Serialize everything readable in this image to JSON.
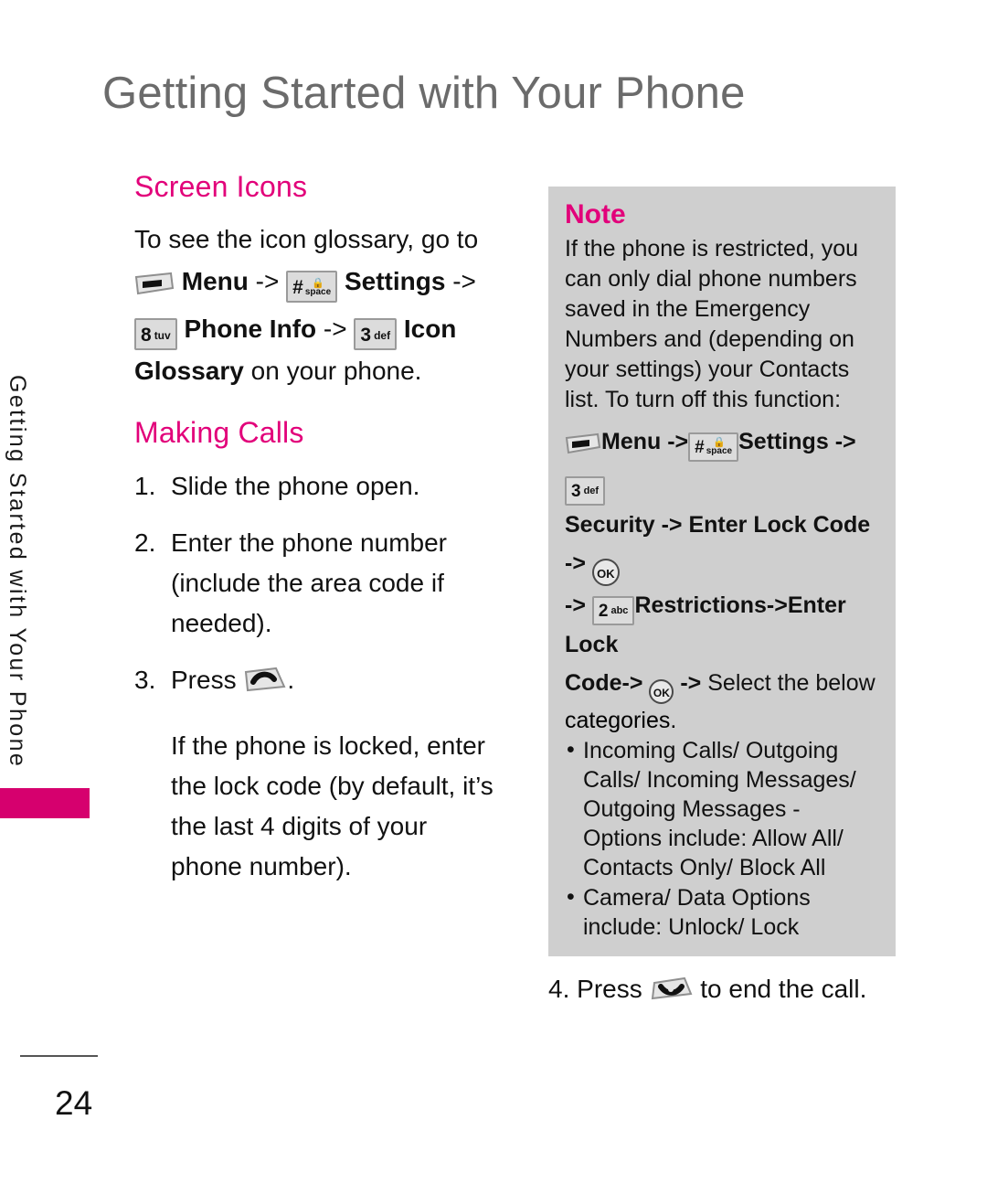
{
  "page": {
    "title": "Getting Started with Your Phone",
    "number": "24",
    "accent_color": "#e2007a",
    "tab_color": "#d6006e",
    "title_color": "#6b6b6b",
    "note_bg_color": "#cfcfcf"
  },
  "side_tab": {
    "label": "Getting Started with Your Phone"
  },
  "left_column": {
    "screen_icons": {
      "heading": "Screen Icons",
      "intro": "To see the icon glossary, go to",
      "menu_label": "Menu",
      "arrow1": "->",
      "settings_label": "Settings",
      "arrow2": "->",
      "phone_info_label": "Phone Info",
      "arrow3": "->",
      "icon_label": "Icon",
      "glossary_label": "Glossary",
      "tail": "on your phone."
    },
    "making_calls": {
      "heading": "Making Calls",
      "steps": [
        {
          "num": "1.",
          "text": "Slide the phone open."
        },
        {
          "num": "2.",
          "text": "Enter the phone number (include the area code if needed)."
        },
        {
          "num": "3.",
          "prefix": "Press",
          "suffix": "."
        }
      ],
      "locked_note": "If the phone is locked, enter the lock code (by default, it’s the last 4 digits of your phone number)."
    }
  },
  "note_box": {
    "title": "Note",
    "body": "If the phone is restricted, you can only dial phone numbers saved in the Emergency Numbers and (depending on your settings) your Contacts list. To turn off this function:",
    "sequence": {
      "menu_label": "Menu",
      "arrow1": "->",
      "settings_label": "Settings",
      "arrow2": "->",
      "security_label": "Security -> Enter Lock Code ->",
      "arrow3": "->",
      "restrictions_label": "Restrictions->Enter Lock",
      "code_label": "Code->",
      "arrow4": "->",
      "select_label": "Select the below"
    },
    "categories_label": "categories.",
    "bullets": [
      "Incoming Calls/ Outgoing Calls/ Incoming Messages/ Outgoing Messages - Options include: Allow All/ Contacts Only/ Block All",
      "Camera/ Data Options include: Unlock/ Lock"
    ]
  },
  "step_four": {
    "num": "4.",
    "prefix": "Press",
    "suffix": "to end the call."
  },
  "keys": {
    "softkey_menu": {
      "icon": "softkey-left-icon",
      "label": ""
    },
    "hash_space": {
      "icon": "hash-space-key-icon",
      "digit": "#",
      "label": "space",
      "lock": "🔒"
    },
    "key_8_tuv": {
      "icon": "key-8-tuv-icon",
      "digit": "8",
      "label": "tuv"
    },
    "key_3_def": {
      "icon": "key-3-def-icon",
      "digit": "3",
      "label": "def"
    },
    "key_2_abc": {
      "icon": "key-2-abc-icon",
      "digit": "2",
      "label": "abc"
    },
    "ok_key": {
      "icon": "ok-key-icon",
      "label": "OK"
    },
    "send_key": {
      "icon": "send-key-icon"
    },
    "end_key": {
      "icon": "end-key-icon"
    }
  }
}
